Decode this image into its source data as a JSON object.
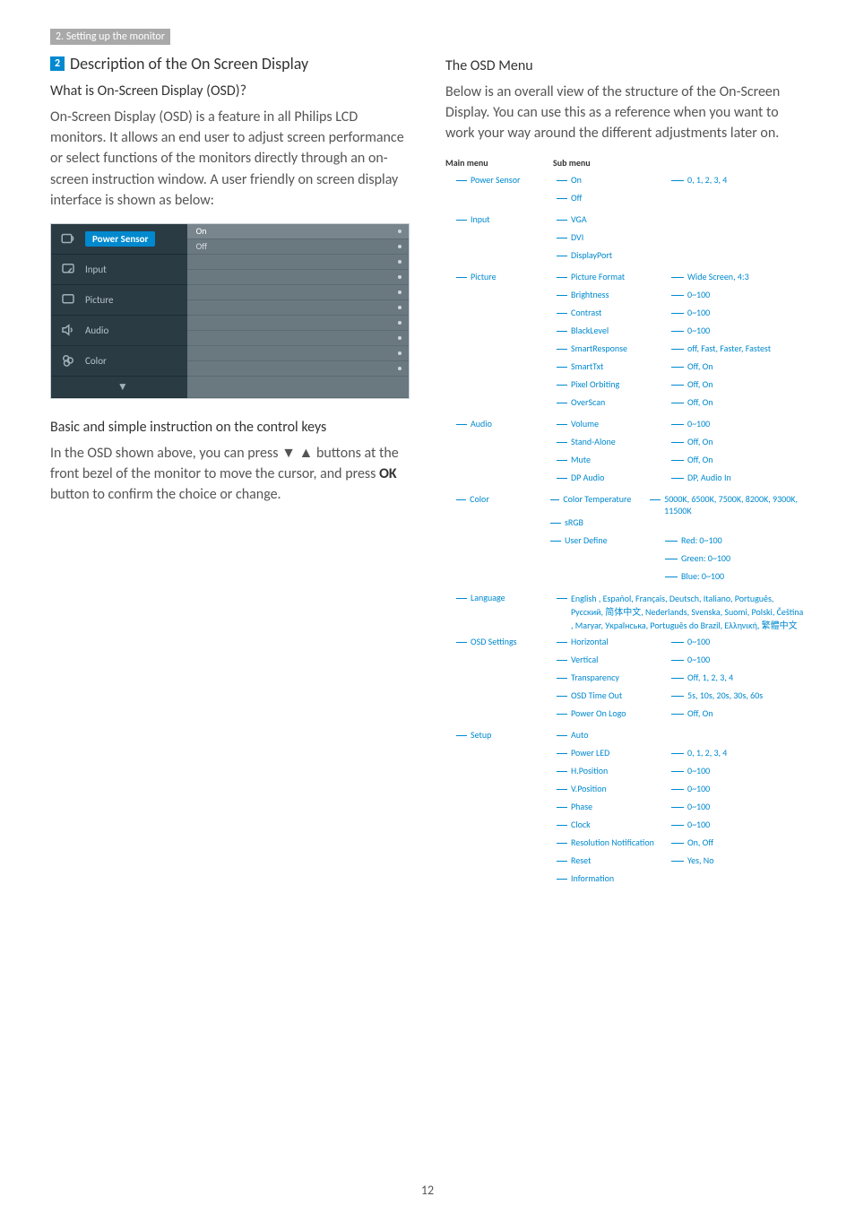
{
  "breadcrumb": "2. Setting up the monitor",
  "section_number": "2",
  "section_title": "Description of the On Screen Display",
  "q_what_is": "What is On-Screen Display (OSD)?",
  "what_is_body": "On-Screen Display (OSD) is a feature in all Philips LCD monitors. It allows an end user to adjust screen performance or select functions of the monitors directly through an on-screen instruction window. A user friendly on screen display interface is shown as below:",
  "osd_mock": {
    "rows": [
      {
        "label": "Power Sensor",
        "opts": [
          "On",
          "Off"
        ],
        "active_row": 0
      },
      {
        "label": "Input",
        "opts": [
          "",
          ""
        ]
      },
      {
        "label": "Picture",
        "opts": [
          "",
          ""
        ]
      },
      {
        "label": "Audio",
        "opts": [
          "",
          ""
        ]
      },
      {
        "label": "Color",
        "opts": [
          "",
          ""
        ]
      }
    ]
  },
  "basic_title": "Basic and simple instruction on the control keys",
  "basic_body_1": "In the OSD shown above, you can press ▼ ▲ buttons at the front bezel of the monitor to move the cursor, and press ",
  "basic_body_ok": "OK",
  "basic_body_2": " button to confirm the choice or change.",
  "right_title": "The OSD Menu",
  "right_body": "Below is an overall view of the structure of the On-Screen Display. You can use this as a reference when you want to work your way around the different adjustments later on.",
  "tree_headers": {
    "main": "Main menu",
    "sub": "Sub menu"
  },
  "menu": [
    {
      "main": "Power Sensor",
      "subs": [
        {
          "label": "On",
          "val": "0, 1, 2, 3, 4"
        },
        {
          "label": "Off"
        }
      ]
    },
    {
      "main": "Input",
      "subs": [
        {
          "label": "VGA"
        },
        {
          "label": "DVI"
        },
        {
          "label": "DisplayPort"
        }
      ]
    },
    {
      "main": "Picture",
      "subs": [
        {
          "label": "Picture Format",
          "val": "Wide Screen, 4:3"
        },
        {
          "label": "Brightness",
          "val": "0~100"
        },
        {
          "label": "Contrast",
          "val": "0~100"
        },
        {
          "label": "BlackLevel",
          "val": "0~100"
        },
        {
          "label": "SmartResponse",
          "val": "off, Fast, Faster, Fastest"
        },
        {
          "label": "SmartTxt",
          "val": "Off, On"
        },
        {
          "label": "Pixel Orbiting",
          "val": "Off, On"
        },
        {
          "label": "OverScan",
          "val": "Off, On"
        }
      ]
    },
    {
      "main": "Audio",
      "subs": [
        {
          "label": "Volume",
          "val": "0~100"
        },
        {
          "label": "Stand-Alone",
          "val": "Off, On"
        },
        {
          "label": "Mute",
          "val": "Off, On"
        },
        {
          "label": "DP Audio",
          "val": "DP, Audio In"
        }
      ]
    },
    {
      "main": "Color",
      "subs": [
        {
          "label": "Color Temperature",
          "val": "5000K, 6500K, 7500K, 8200K, 9300K, 11500K"
        },
        {
          "label": "sRGB"
        },
        {
          "label": "User Define",
          "vals": [
            "Red: 0~100",
            "Green: 0~100",
            "Blue: 0~100"
          ]
        }
      ]
    },
    {
      "main": "Language",
      "lang": "English , Español, Français, Deutsch, Italiano, Português, Русский, 简体中文, Nederlands, Svenska, Suomi, Polski, Čeština , Maryar, Українська, Português do Brazil, Ελληνική, 繁體中文"
    },
    {
      "main": "OSD Settings",
      "subs": [
        {
          "label": "Horizontal",
          "val": "0~100"
        },
        {
          "label": "Vertical",
          "val": "0~100"
        },
        {
          "label": "Transparency",
          "val": "Off, 1, 2, 3, 4"
        },
        {
          "label": "OSD Time Out",
          "val": "5s, 10s, 20s, 30s, 60s"
        },
        {
          "label": "Power On Logo",
          "val": "Off, On"
        }
      ]
    },
    {
      "main": "Setup",
      "subs": [
        {
          "label": "Auto"
        },
        {
          "label": "Power LED",
          "val": "0, 1, 2, 3, 4"
        },
        {
          "label": "H.Position",
          "val": "0~100"
        },
        {
          "label": "V.Position",
          "val": "0~100"
        },
        {
          "label": "Phase",
          "val": "0~100"
        },
        {
          "label": "Clock",
          "val": "0~100"
        },
        {
          "label": "Resolution Notification",
          "val": "On, Off"
        },
        {
          "label": "Reset",
          "val": "Yes, No"
        },
        {
          "label": "Information"
        }
      ]
    }
  ],
  "page_number": "12"
}
